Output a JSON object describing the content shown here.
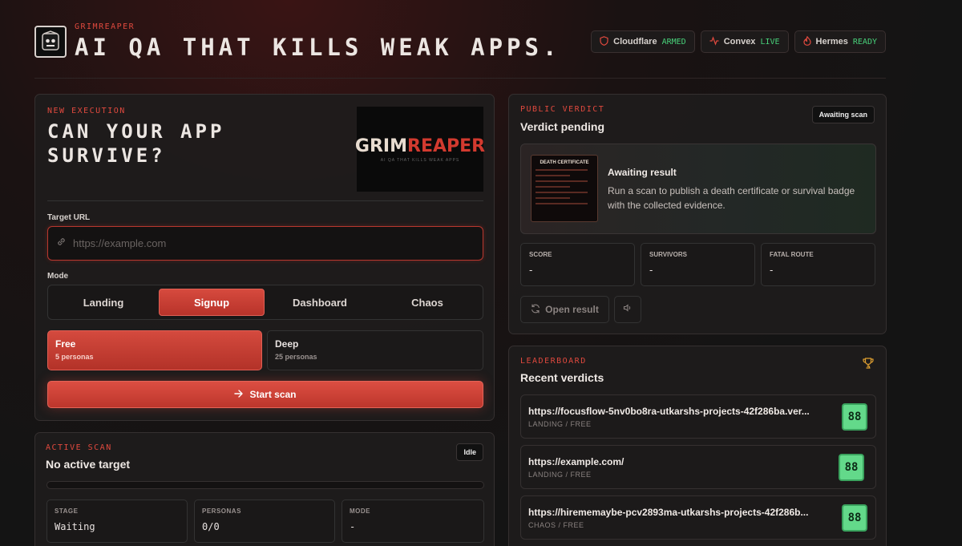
{
  "header": {
    "brand": "GRIMREAPER",
    "tagline": "AI QA THAT KILLS WEAK APPS.",
    "statuses": [
      {
        "name": "Cloudflare",
        "state": "ARMED",
        "icon": "shield-icon"
      },
      {
        "name": "Convex",
        "state": "LIVE",
        "icon": "activity-icon"
      },
      {
        "name": "Hermes",
        "state": "READY",
        "icon": "flame-icon"
      }
    ],
    "status_color": "#48d17a",
    "accent": "#e0493e"
  },
  "execution": {
    "label": "NEW EXECUTION",
    "hero_line1": "CAN YOUR APP",
    "hero_line2": "SURVIVE?",
    "thumb_title_a": "GRIM",
    "thumb_title_b": "REAPER",
    "thumb_sub": "AI QA THAT KILLS WEAK APPS",
    "url_label": "Target URL",
    "url_placeholder": "https://example.com",
    "url_value": "",
    "mode_label": "Mode",
    "modes": [
      "Landing",
      "Signup",
      "Dashboard",
      "Chaos"
    ],
    "active_mode": "Signup",
    "plans": [
      {
        "name": "Free",
        "sub": "5 personas"
      },
      {
        "name": "Deep",
        "sub": "25 personas"
      }
    ],
    "selected_plan": "Free",
    "start_label": "Start scan"
  },
  "active_scan": {
    "label": "ACTIVE SCAN",
    "title": "No active target",
    "badge": "Idle",
    "progress": 0,
    "stats": [
      {
        "key": "STAGE",
        "value": "Waiting"
      },
      {
        "key": "PERSONAS",
        "value": "0/0"
      },
      {
        "key": "MODE",
        "value": "-"
      }
    ]
  },
  "verdict": {
    "label": "PUBLIC VERDICT",
    "title": "Verdict pending",
    "badge": "Awaiting scan",
    "cert_title": "DEATH CERTIFICATE",
    "card_title": "Awaiting result",
    "card_text": "Run a scan to publish a death certificate or survival badge with the collected evidence.",
    "stats": [
      {
        "key": "SCORE",
        "value": "-"
      },
      {
        "key": "SURVIVORS",
        "value": "-"
      },
      {
        "key": "FATAL ROUTE",
        "value": "-"
      }
    ],
    "open_label": "Open result"
  },
  "leaderboard": {
    "label": "LEADERBOARD",
    "title": "Recent verdicts",
    "rows": [
      {
        "url": "https://focusflow-5nv0bo8ra-utkarshs-projects-42f286ba.ver...",
        "meta": "LANDING / FREE",
        "score": "88"
      },
      {
        "url": "https://example.com/",
        "meta": "LANDING / FREE",
        "score": "88"
      },
      {
        "url": "https://hirememaybe-pcv2893ma-utkarshs-projects-42f286b...",
        "meta": "CHAOS / FREE",
        "score": "88"
      }
    ]
  }
}
